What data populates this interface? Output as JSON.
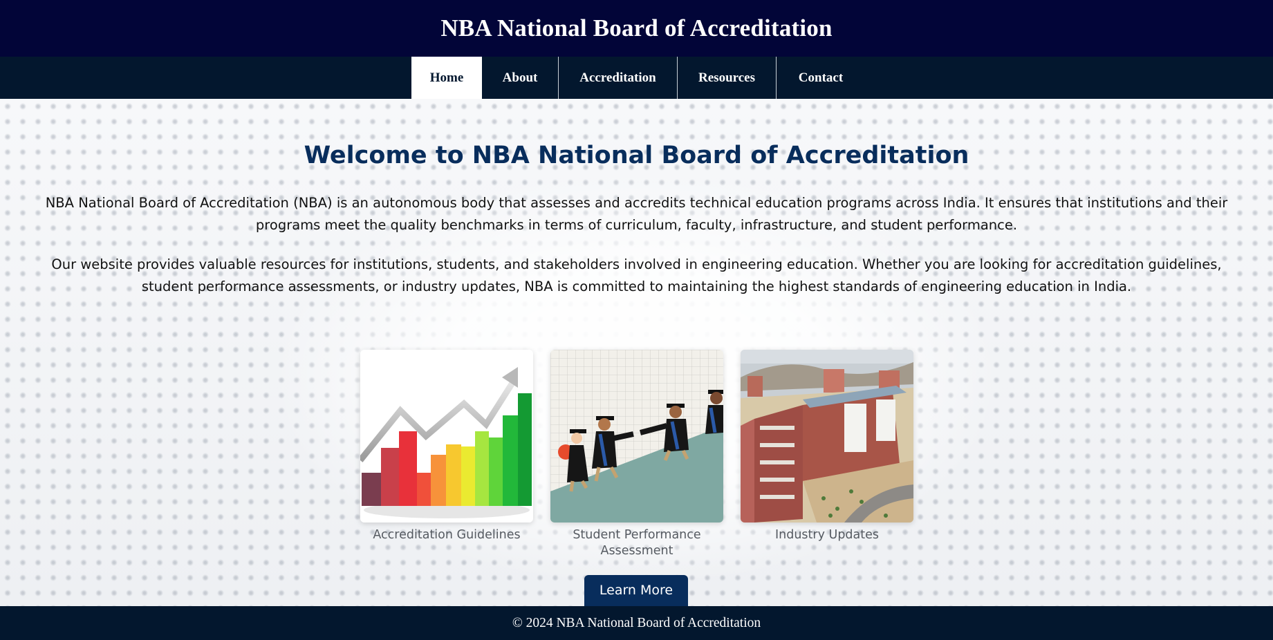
{
  "header": {
    "title": "NBA National Board of Accreditation"
  },
  "nav": {
    "items": [
      {
        "label": "Home",
        "active": true
      },
      {
        "label": "About",
        "active": false
      },
      {
        "label": "Accreditation",
        "active": false
      },
      {
        "label": "Resources",
        "active": false
      },
      {
        "label": "Contact",
        "active": false
      }
    ]
  },
  "main": {
    "title": "Welcome to NBA National Board of Accreditation",
    "paragraphs": [
      "NBA National Board of Accreditation (NBA) is an autonomous body that assesses and accredits technical education programs across India. It ensures that institutions and their programs meet the quality benchmarks in terms of curriculum, faculty, infrastructure, and student performance.",
      "Our website provides valuable resources for institutions, students, and stakeholders involved in engineering education. Whether you are looking for accreditation guidelines, student performance assessments, or industry updates, NBA is committed to maintaining the highest standards of engineering education in India."
    ],
    "cards": [
      {
        "label": "Accreditation Guidelines",
        "image": "bar-graph-growth-image"
      },
      {
        "label": "Student Performance Assessment",
        "image": "graduates-climbing-image"
      },
      {
        "label": "Industry Updates",
        "image": "campus-building-image"
      }
    ],
    "button_label": "Learn More"
  },
  "footer": {
    "text": "© 2024 NBA National Board of Accreditation"
  },
  "colors": {
    "header_bg": "#020538",
    "nav_bg": "#03172e",
    "title_color": "#082d5c",
    "button_bg": "#082d5c"
  }
}
